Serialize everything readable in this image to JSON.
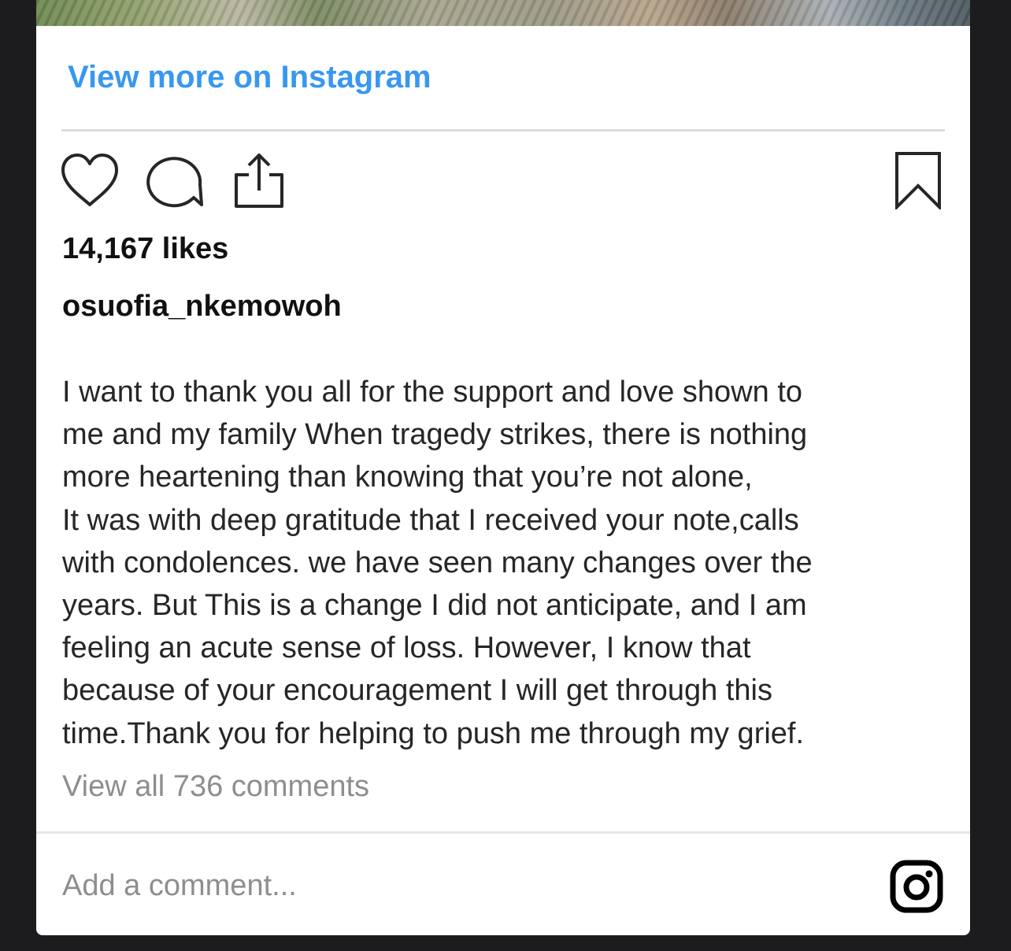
{
  "post": {
    "view_more_label": "View more on Instagram",
    "likes": "14,167 likes",
    "username": "osuofia_nkemowoh",
    "caption_lines": [
      "I want to thank you all for the support and love shown to",
      "me and my family When tragedy strikes, there is nothing",
      "more heartening than knowing that you’re not alone,",
      "It was with deep gratitude that I received your note,calls",
      "with condolences. we have seen many changes over the",
      "years. But This is a change I did not anticipate, and I am",
      "feeling an acute sense of loss. However, I know that",
      "because of your encouragement I will get through this",
      "time.Thank you for helping to push me through my grief."
    ],
    "view_comments": "View all 736 comments",
    "comment_placeholder": "Add a comment..."
  },
  "icons": {
    "like": "heart-icon",
    "comment": "comment-bubble-icon",
    "share": "share-icon",
    "save": "bookmark-icon",
    "brand": "instagram-logo-icon"
  },
  "colors": {
    "link": "#3897f0",
    "text": "#262626",
    "muted": "#8e8e8e"
  }
}
